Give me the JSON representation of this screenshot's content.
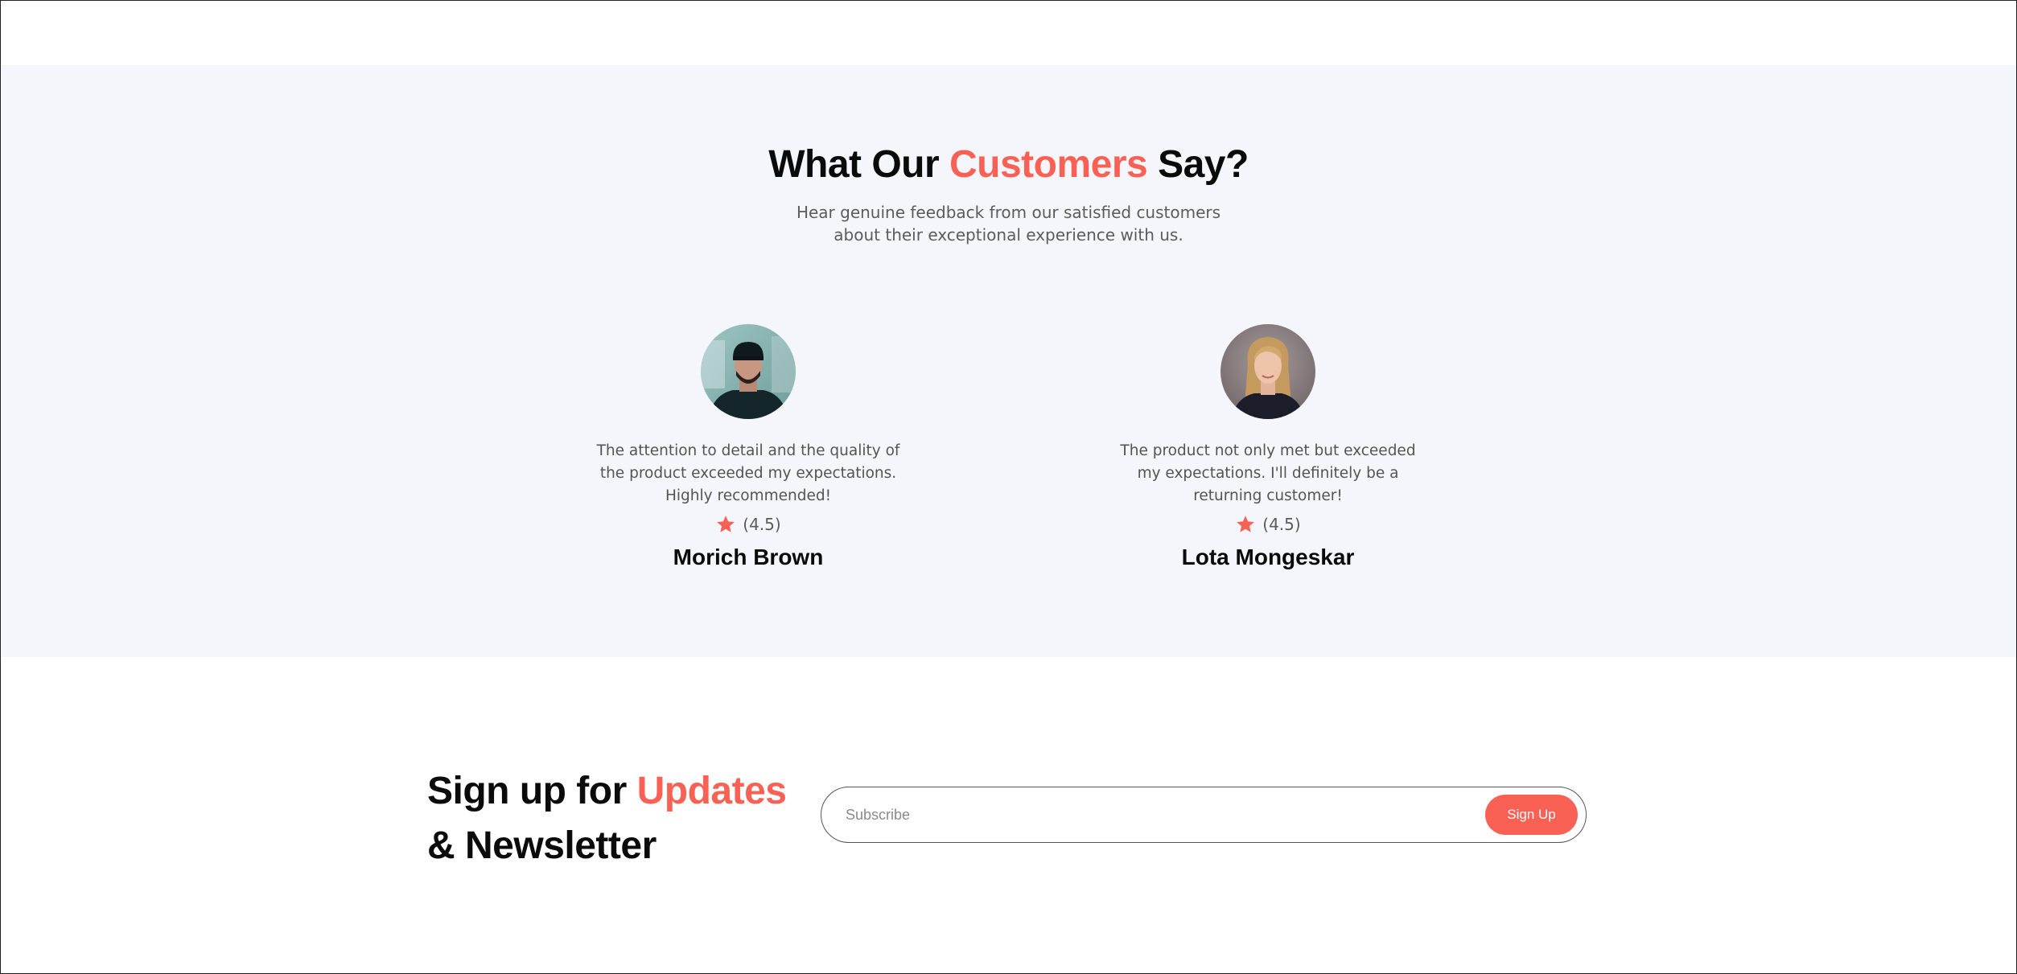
{
  "testimonials": {
    "heading_before": "What Our ",
    "heading_accent": "Customers",
    "heading_after": " Say?",
    "subtitle_line1": "Hear genuine feedback from our satisfied customers",
    "subtitle_line2": "about their exceptional experience with us.",
    "accent_color": "#fa6155",
    "items": [
      {
        "quote_line1": "The attention to detail and the quality of",
        "quote_line2": "the product exceeded my expectations.",
        "quote_line3": "Highly recommended!",
        "rating": "(4.5)",
        "name": "Morich Brown",
        "icon": "star-icon"
      },
      {
        "quote_line1": "The product not only met but exceeded",
        "quote_line2": "my expectations. I'll definitely be a",
        "quote_line3": "returning customer!",
        "rating": "(4.5)",
        "name": "Lota Mongeskar",
        "icon": "star-icon"
      }
    ]
  },
  "newsletter": {
    "title_before": "Sign up for ",
    "title_accent": "Updates",
    "title_line2": "& Newsletter",
    "input_placeholder": "Subscribe",
    "button_label": "Sign Up"
  }
}
